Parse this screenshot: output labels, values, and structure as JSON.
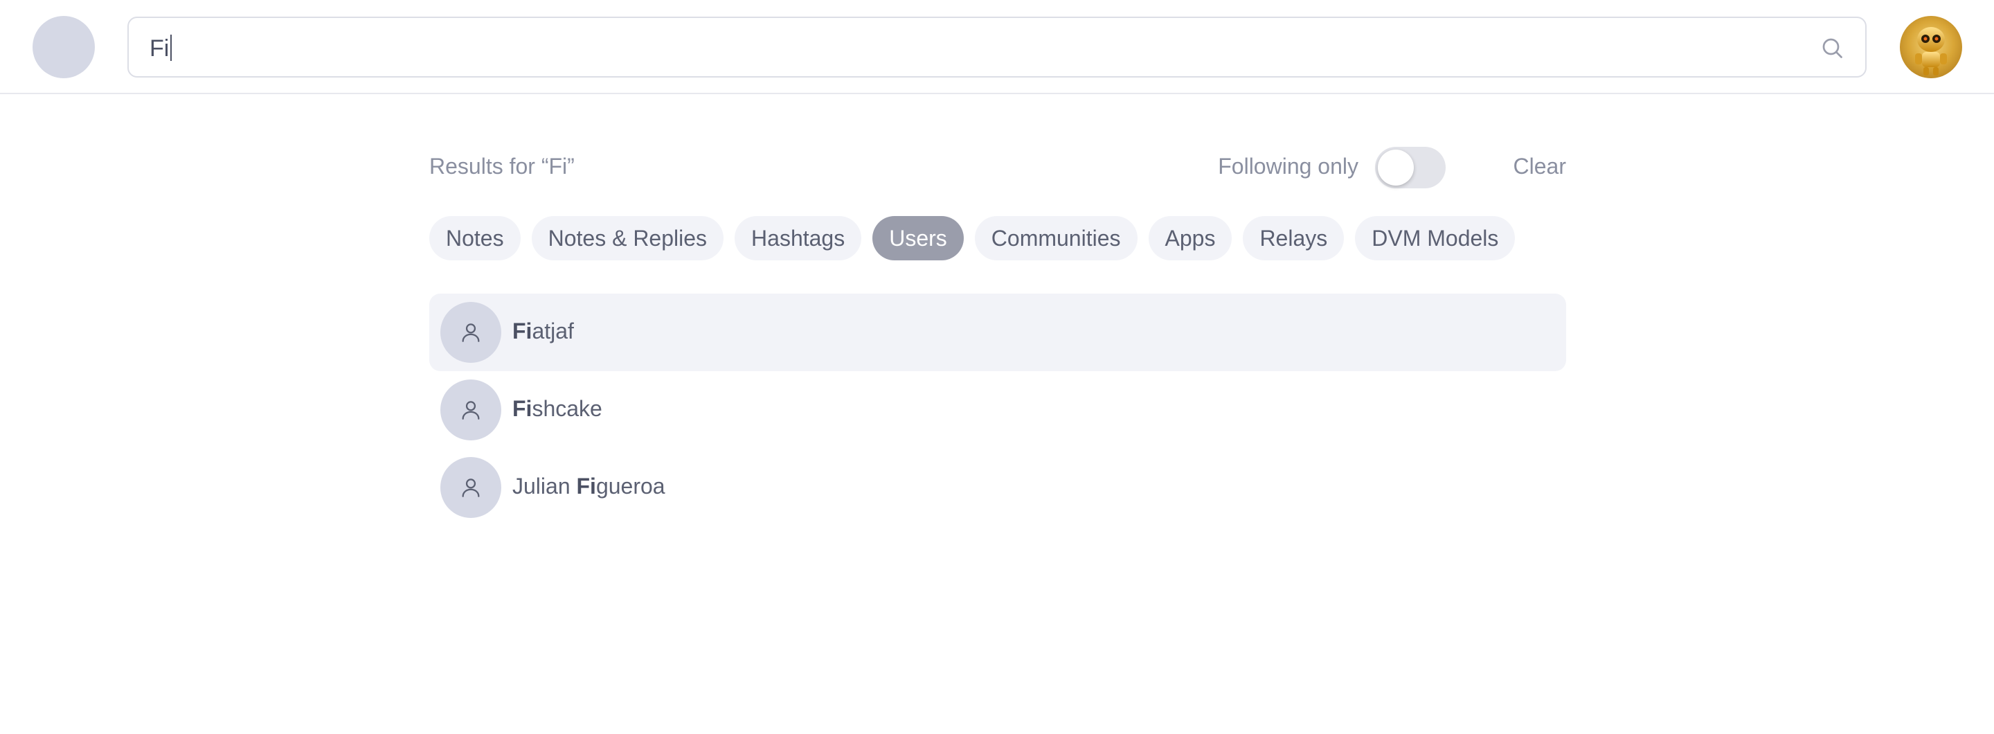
{
  "search": {
    "value": "Fi",
    "icon": "search-icon"
  },
  "header": {
    "logo_color": "#d5d8e5",
    "avatar_icon": "robot-avatar"
  },
  "results": {
    "label": "Results for “Fi”",
    "following_label": "Following only",
    "following_enabled": false,
    "clear_label": "Clear"
  },
  "tabs": [
    {
      "label": "Notes",
      "active": false
    },
    {
      "label": "Notes & Replies",
      "active": false
    },
    {
      "label": "Hashtags",
      "active": false
    },
    {
      "label": "Users",
      "active": true
    },
    {
      "label": "Communities",
      "active": false
    },
    {
      "label": "Apps",
      "active": false
    },
    {
      "label": "Relays",
      "active": false
    },
    {
      "label": "DVM Models",
      "active": false
    }
  ],
  "users": [
    {
      "before": "",
      "match": "Fi",
      "after": "atjaf",
      "highlighted": true
    },
    {
      "before": "",
      "match": "Fi",
      "after": "shcake",
      "highlighted": false
    },
    {
      "before": "Julian ",
      "match": "Fi",
      "after": "gueroa",
      "highlighted": false
    }
  ],
  "colors": {
    "accent_tab": "#9a9dab",
    "tab_bg": "#f2f3f8",
    "avatar_placeholder": "#d5d8e5"
  }
}
